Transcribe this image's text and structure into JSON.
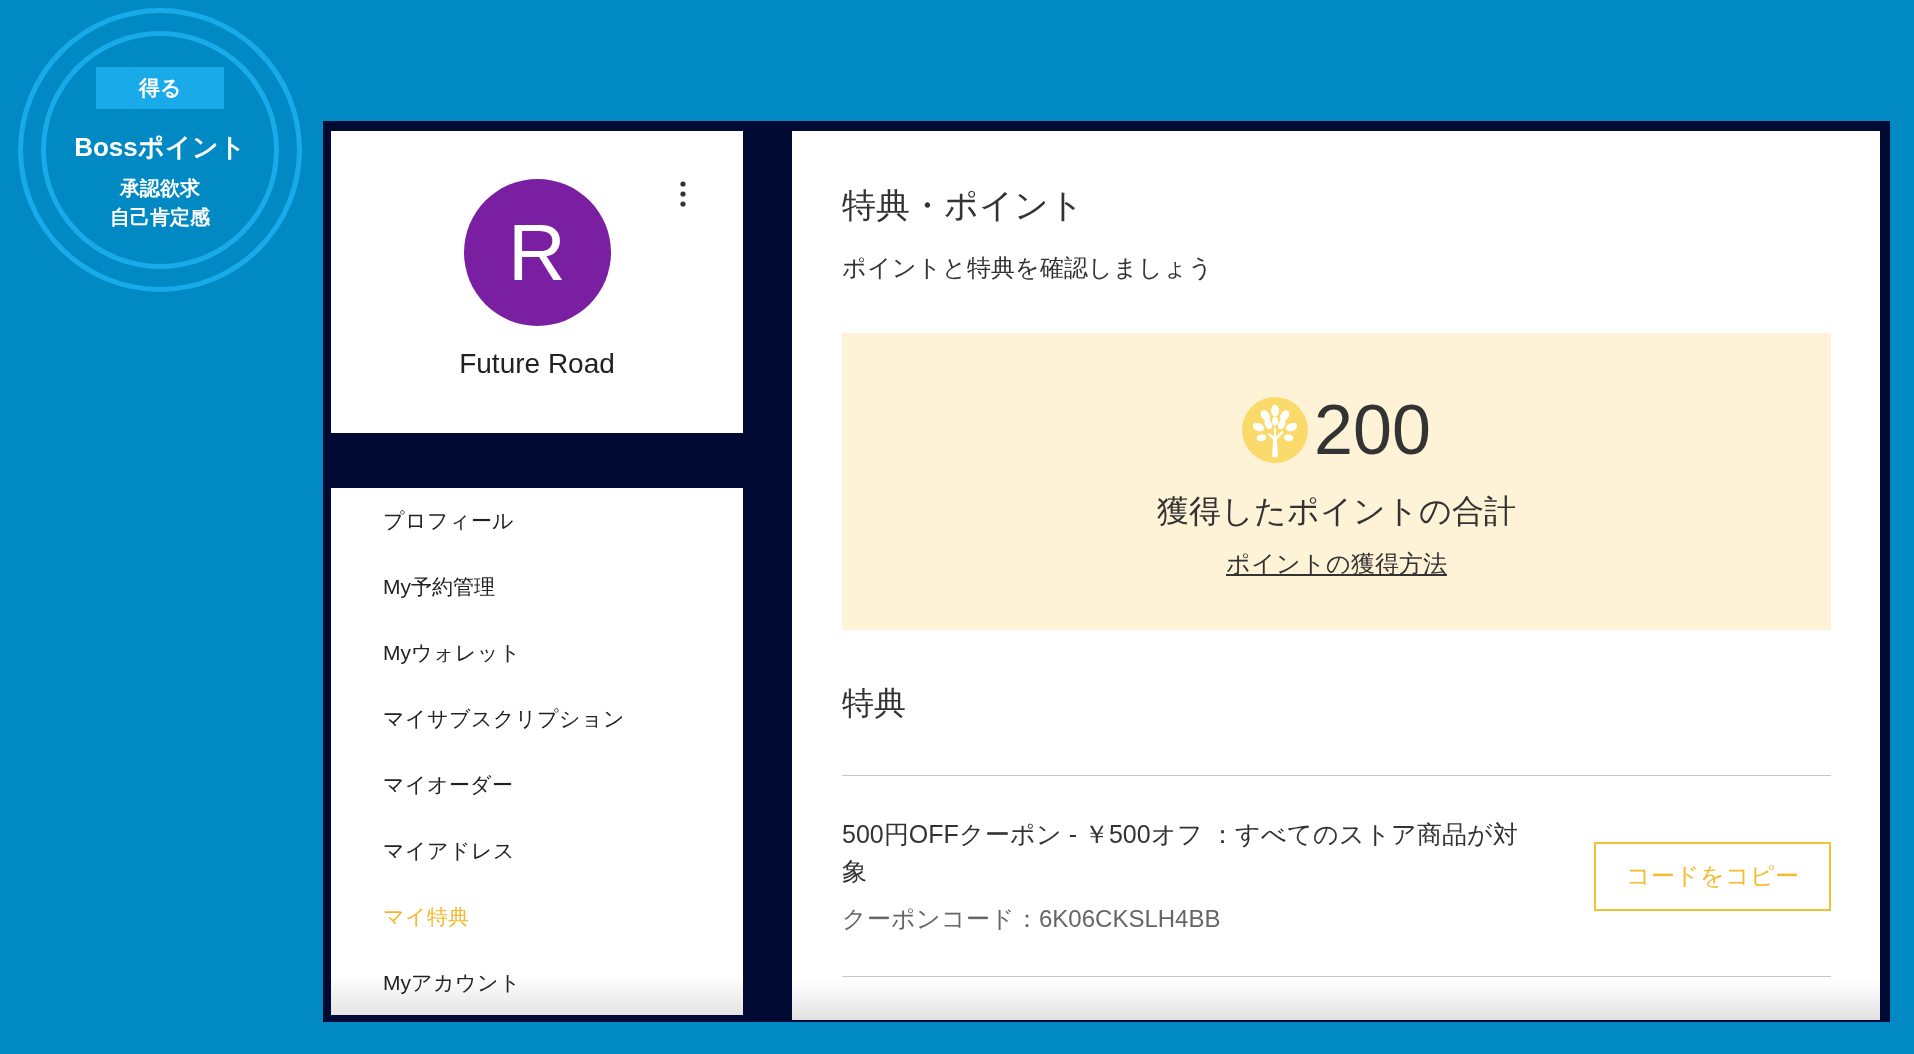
{
  "badge": {
    "tag": "得る",
    "title": "Bossポイント",
    "lines": [
      "承認欲求",
      "自己肯定感"
    ]
  },
  "profile": {
    "initial": "R",
    "name": "Future Road"
  },
  "sidebar": {
    "items": [
      {
        "label": "プロフィール",
        "selected": false
      },
      {
        "label": "My予約管理",
        "selected": false
      },
      {
        "label": "Myウォレット",
        "selected": false
      },
      {
        "label": "マイサブスクリプション",
        "selected": false
      },
      {
        "label": "マイオーダー",
        "selected": false
      },
      {
        "label": "マイアドレス",
        "selected": false
      },
      {
        "label": "マイ特典",
        "selected": true
      },
      {
        "label": "Myアカウント",
        "selected": false
      }
    ]
  },
  "main": {
    "title": "特典・ポイント",
    "subtitle": "ポイントと特典を確認しましょう",
    "points": {
      "value": "200",
      "caption": "獲得したポイントの合計",
      "link": "ポイントの獲得方法"
    },
    "section_title": "特典",
    "coupons": [
      {
        "title": "500円OFFクーポン - ￥500オフ ：すべてのストア商品が対象",
        "code": "クーポンコード：6K06CKSLH4BB",
        "button": "コードをコピー"
      }
    ]
  }
}
